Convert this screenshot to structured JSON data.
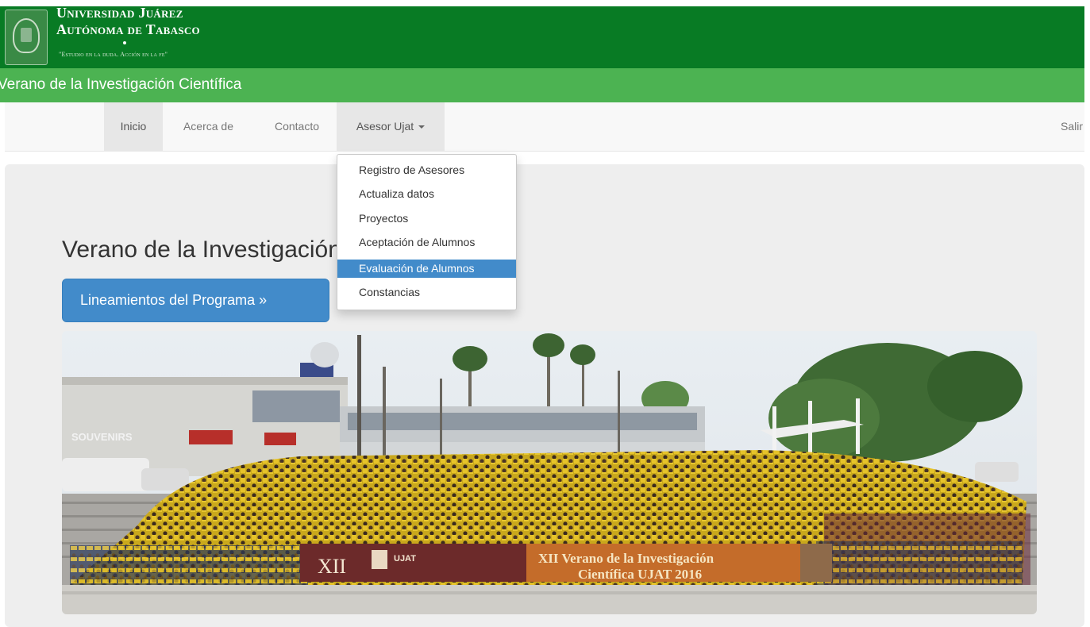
{
  "header": {
    "university_line1": "Universidad Juárez",
    "university_line2": "Autónoma de Tabasco",
    "motto": "\"Estudio en la duda. Acción en la fe\"",
    "brand_color": "#087b24"
  },
  "subheader": {
    "title": "Verano de la Investigación Científica",
    "color": "#4cb352"
  },
  "nav": {
    "items": [
      {
        "label": "Inicio"
      },
      {
        "label": "Acerca de"
      },
      {
        "label": "Contacto"
      },
      {
        "label": "Asesor Ujat"
      }
    ],
    "logout": "Salir"
  },
  "dropdown": {
    "items": [
      {
        "label": "Registro de Asesores"
      },
      {
        "label": "Actualiza datos"
      },
      {
        "label": "Proyectos"
      },
      {
        "label": "Aceptación de Alumnos"
      },
      {
        "label": "Evaluación de Alumnos",
        "highlighted": true
      },
      {
        "label": "Constancias"
      }
    ]
  },
  "hero": {
    "title": "Verano de la Investigación Científica UJAT",
    "button": "Lineamientos del Programa »"
  },
  "photo": {
    "banner_roman": "XII",
    "banner_logo": "UJAT",
    "banner_line1": "XII Verano de la Investigación",
    "banner_line2": "Científica UJAT 2016",
    "store_sign": "SOUVENIRS"
  }
}
